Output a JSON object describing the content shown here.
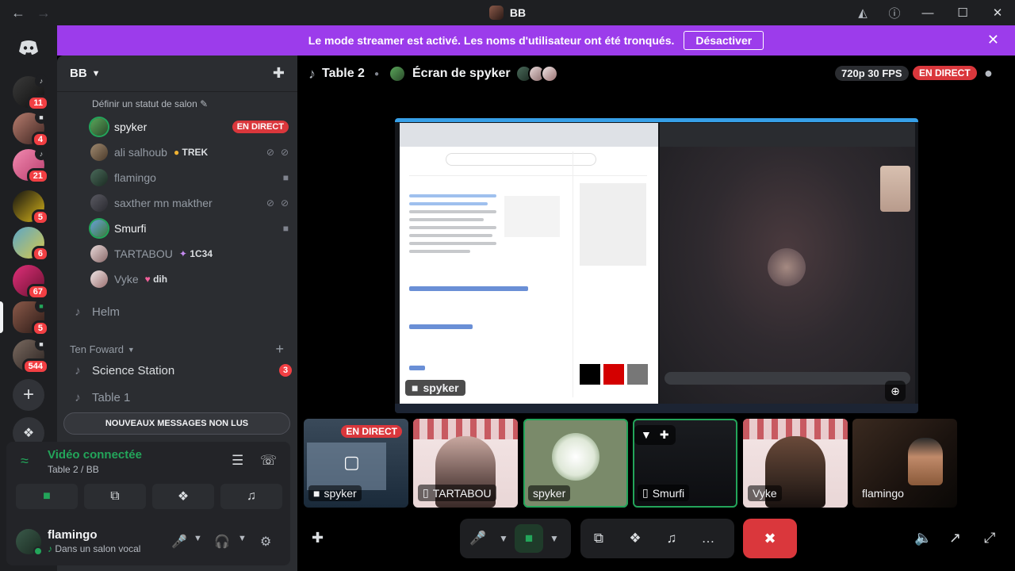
{
  "titlebar": {
    "title": "BB",
    "back_icon": "arrow-left-icon",
    "forward_icon": "arrow-right-icon",
    "inbox_icon": "inbox-icon",
    "help_icon": "help-icon"
  },
  "banner": {
    "message": "Le mode streamer est activé. Les noms d'utilisateur ont été tronqués.",
    "button": "Désactiver"
  },
  "server_rail": {
    "items": [
      {
        "badge": "11"
      },
      {
        "badge": "4"
      },
      {
        "badge": "21"
      },
      {
        "badge": "5"
      },
      {
        "badge": "6"
      },
      {
        "badge": "67"
      },
      {
        "badge": "5"
      },
      {
        "badge": "544"
      }
    ]
  },
  "guild": {
    "name": "BB",
    "set_status": "Définir un statut de salon"
  },
  "members": [
    {
      "name": "spyker",
      "live": "EN DIRECT"
    },
    {
      "name": "ali salhoub",
      "tag": "TREK"
    },
    {
      "name": "flamingo"
    },
    {
      "name": "saxther mn makther"
    },
    {
      "name": "Smurfi"
    },
    {
      "name": "TARTABOU",
      "tag": "1C34"
    },
    {
      "name": "Vyke",
      "tag": "dih"
    }
  ],
  "channels": {
    "helm": "Helm",
    "category": "Ten Foward",
    "science": "Science Station",
    "science_badge": "3",
    "table1": "Table 1",
    "unread": "NOUVEAUX MESSAGES NON LUS"
  },
  "voice_status": {
    "status": "Vidéo connectée",
    "channel": "Table 2 / BB"
  },
  "user": {
    "name": "flamingo",
    "status": "Dans un salon vocal"
  },
  "main_header": {
    "channel": "Table 2",
    "screen": "Écran de spyker",
    "quality": "720p 30 FPS",
    "live": "EN DIRECT"
  },
  "stream": {
    "owner": "spyker"
  },
  "tiles": [
    {
      "name": "spyker",
      "live": "EN DIRECT"
    },
    {
      "name": "TARTABOU"
    },
    {
      "name": "spyker"
    },
    {
      "name": "Smurfi"
    },
    {
      "name": "Vyke"
    },
    {
      "name": "flamingo"
    }
  ],
  "colors": {
    "banner": "#9c3ceb",
    "live_red": "#da373c",
    "connected_green": "#23a55a",
    "badge_red": "#f23f43"
  }
}
